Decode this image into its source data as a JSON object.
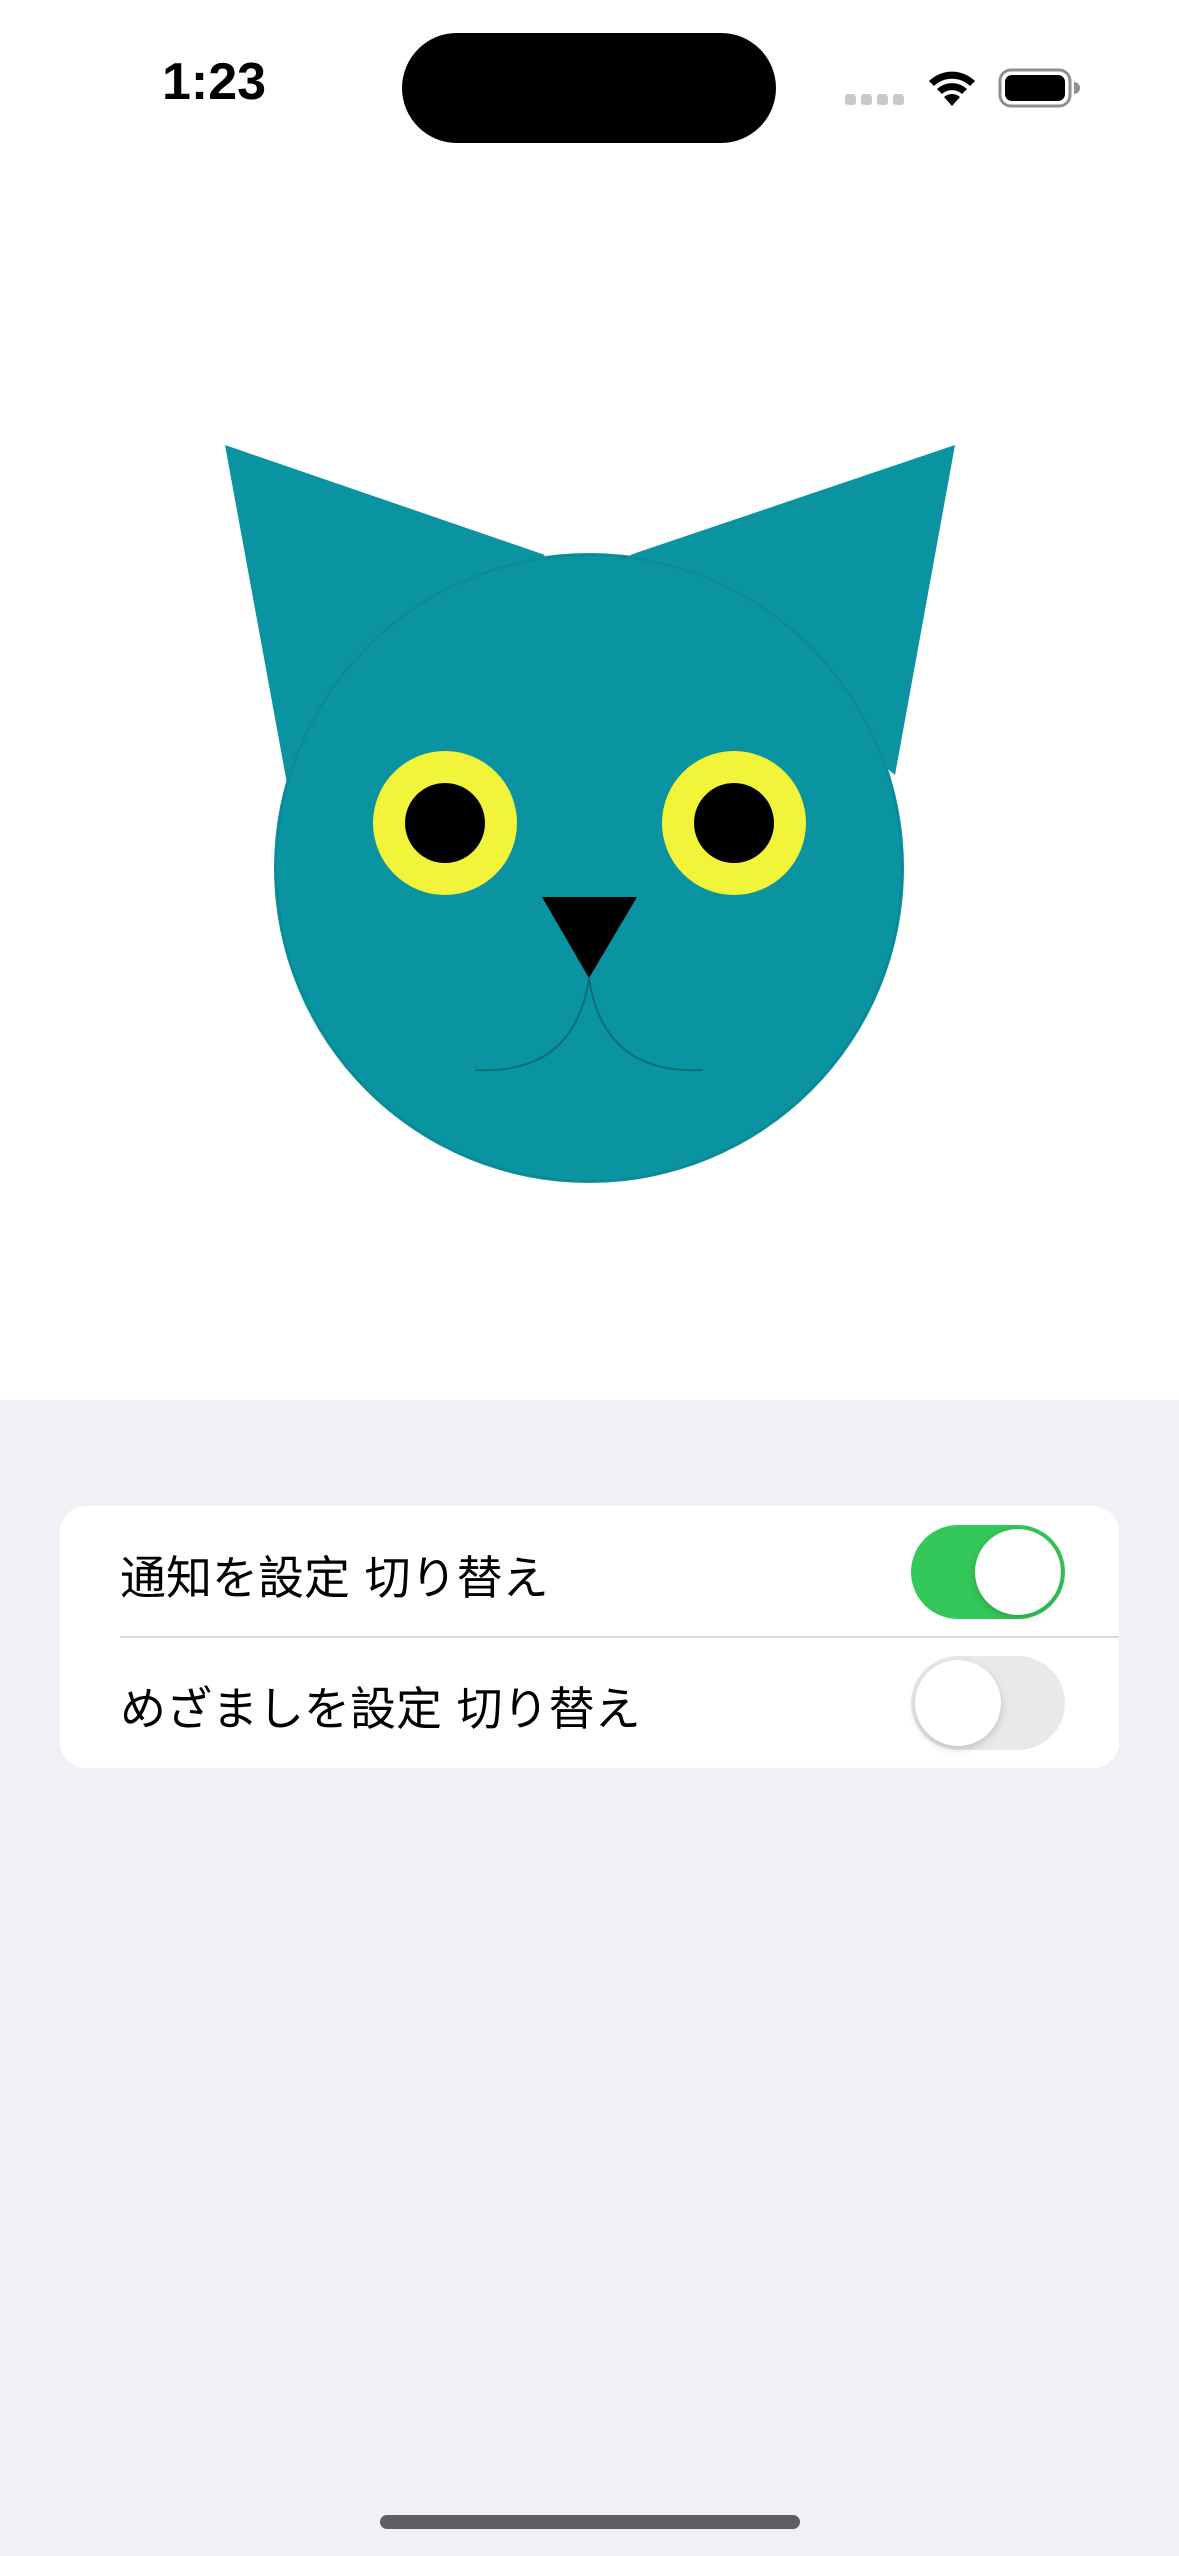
{
  "status_bar": {
    "time": "1:23"
  },
  "icons": {
    "signal": "cellular-signal-icon",
    "wifi": "wifi-icon",
    "battery": "battery-icon"
  },
  "cat_illustration": {
    "face_color": "#0a93a0",
    "eye_color": "#f2f43a",
    "pupil_color": "#000000",
    "nose_color": "#000000"
  },
  "settings": {
    "rows": [
      {
        "label": "通知を設定 切り替え",
        "enabled": true
      },
      {
        "label": "めざましを設定 切り替え",
        "enabled": false
      }
    ]
  },
  "colors": {
    "toggle_on": "#34c759",
    "toggle_off": "#e9e9eb",
    "grouped_background": "#f1f0f6"
  }
}
